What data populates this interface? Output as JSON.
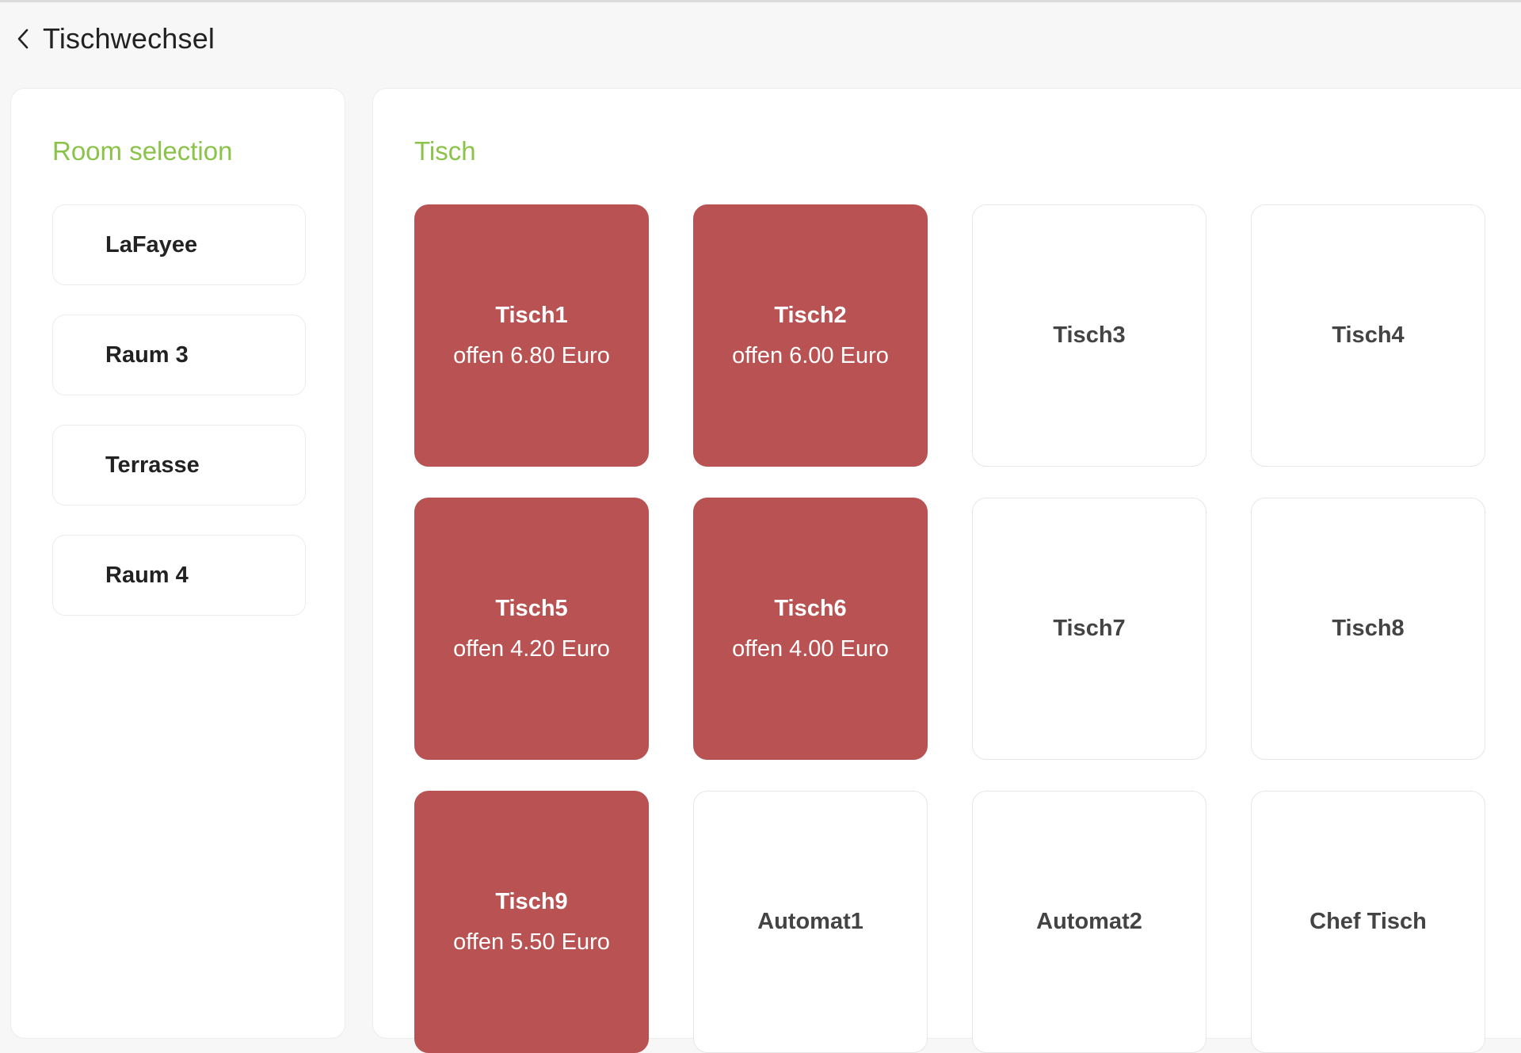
{
  "header": {
    "title": "Tischwechsel",
    "back_icon": "chevron-left-icon"
  },
  "sidebar": {
    "title": "Room selection",
    "rooms": [
      {
        "label": "LaFayee"
      },
      {
        "label": "Raum 3"
      },
      {
        "label": "Terrasse"
      },
      {
        "label": "Raum 4"
      }
    ]
  },
  "main": {
    "title": "Tisch",
    "tables": [
      {
        "name": "Tisch1",
        "amount": "offen 6.80 Euro",
        "occupied": true
      },
      {
        "name": "Tisch2",
        "amount": "offen 6.00 Euro",
        "occupied": true
      },
      {
        "name": "Tisch3",
        "amount": "",
        "occupied": false
      },
      {
        "name": "Tisch4",
        "amount": "",
        "occupied": false
      },
      {
        "name": "Tisch5",
        "amount": "offen 4.20 Euro",
        "occupied": true
      },
      {
        "name": "Tisch6",
        "amount": "offen 4.00 Euro",
        "occupied": true
      },
      {
        "name": "Tisch7",
        "amount": "",
        "occupied": false
      },
      {
        "name": "Tisch8",
        "amount": "",
        "occupied": false
      },
      {
        "name": "Tisch9",
        "amount": "offen 5.50 Euro",
        "occupied": true
      },
      {
        "name": "Automat1",
        "amount": "",
        "occupied": false
      },
      {
        "name": "Automat2",
        "amount": "",
        "occupied": false
      },
      {
        "name": "Chef Tisch",
        "amount": "",
        "occupied": false
      }
    ]
  },
  "colors": {
    "accent": "#8bc34a",
    "occupied": "#b95252",
    "text": "#222222"
  }
}
